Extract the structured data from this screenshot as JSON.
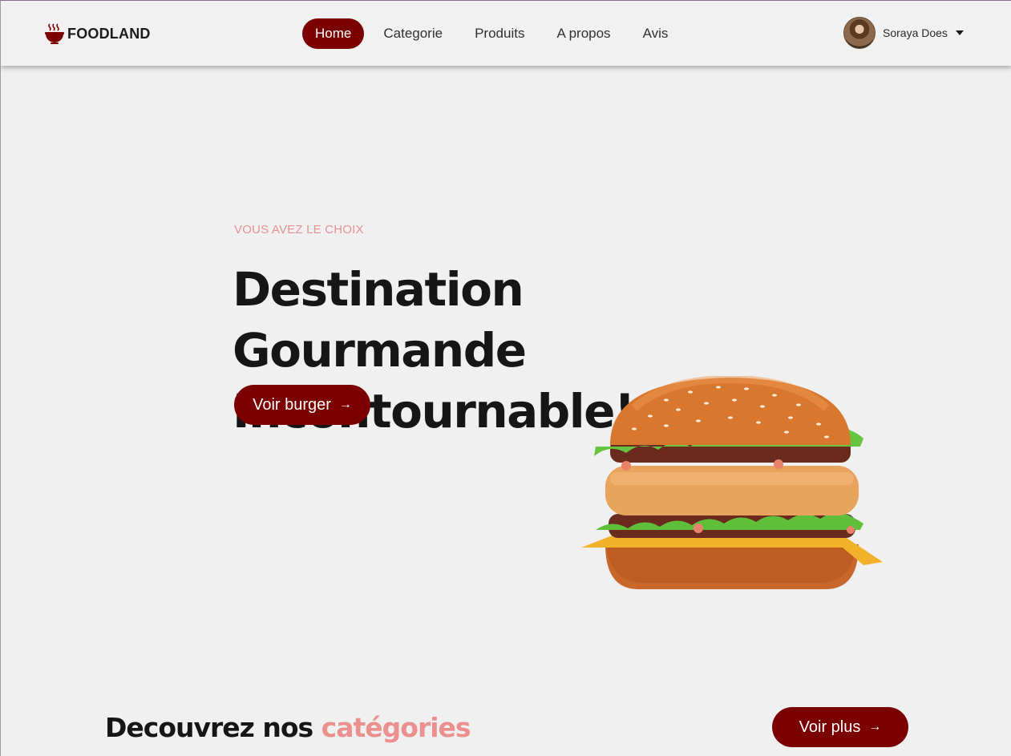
{
  "brand": {
    "name": "FOODLAND",
    "icon": "steaming-bowl-icon",
    "color": "#7b0000"
  },
  "nav": {
    "links": [
      {
        "label": "Home",
        "active": true
      },
      {
        "label": "Categorie",
        "active": false
      },
      {
        "label": "Produits",
        "active": false
      },
      {
        "label": "A propos",
        "active": false
      },
      {
        "label": "Avis",
        "active": false
      }
    ]
  },
  "user": {
    "name": "Soraya Does",
    "menu_icon": "caret-down-icon"
  },
  "hero": {
    "eyebrow": "VOUS AVEZ LE CHOIX",
    "title_line1": "Destination Gourmande",
    "title_line2": "Incontournable!",
    "button_label": "Voir burger",
    "button_icon": "arrow-right-icon",
    "image": "burger-image"
  },
  "categories": {
    "title_prefix": "Decouvrez nos",
    "title_accent": "catégories",
    "button_label": "Voir plus",
    "button_icon": "arrow-right-icon",
    "accent_color": "#ec8f8f"
  }
}
